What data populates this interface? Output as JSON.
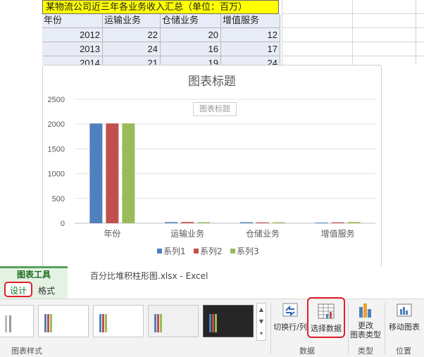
{
  "sheet": {
    "title_row": "某物流公司近三年各业务收入汇总（单位：百万）",
    "headers": [
      "年份",
      "运输业务",
      "仓储业务",
      "增值服务"
    ],
    "rows": [
      [
        "2012",
        "22",
        "20",
        "12"
      ],
      [
        "2013",
        "24",
        "16",
        "17"
      ],
      [
        "2014",
        "21",
        "19",
        "24"
      ]
    ]
  },
  "chart_data": {
    "type": "bar",
    "title": "图表标题",
    "axis_title_placeholder": "图表标题",
    "categories": [
      "年份",
      "运输业务",
      "仓储业务",
      "增值服务"
    ],
    "series": [
      {
        "name": "系列1",
        "color": "#4f81bd",
        "values": [
          2012,
          22,
          20,
          12
        ]
      },
      {
        "name": "系列2",
        "color": "#c0504d",
        "values": [
          2013,
          24,
          16,
          17
        ]
      },
      {
        "name": "系列3",
        "color": "#9bbb59",
        "values": [
          2014,
          21,
          19,
          24
        ]
      }
    ],
    "yticks": [
      "0",
      "500",
      "1000",
      "1500",
      "2000",
      "2500"
    ],
    "ylim": [
      0,
      2500
    ],
    "grid": true,
    "legend": "bottom"
  },
  "ribbon": {
    "context_label": "图表工具",
    "tabs": [
      "设计",
      "格式"
    ],
    "document_title": "百分比堆积柱形图.xlsx - Excel",
    "groups": {
      "styles": "图表样式",
      "data": "数据",
      "type": "类型",
      "location": "位置"
    },
    "buttons": {
      "switch_row_col": "切换行/列",
      "select_data": "选择数据",
      "change_type_line1": "更改",
      "change_type_line2": "图表类型",
      "move_chart": "移动图表"
    },
    "scroll_symbols": [
      "▲",
      "▼",
      "▾"
    ]
  },
  "colors": {
    "accent_green": "#5aa15a",
    "highlight_red": "#e0202a",
    "title_fill": "#ffff00"
  }
}
